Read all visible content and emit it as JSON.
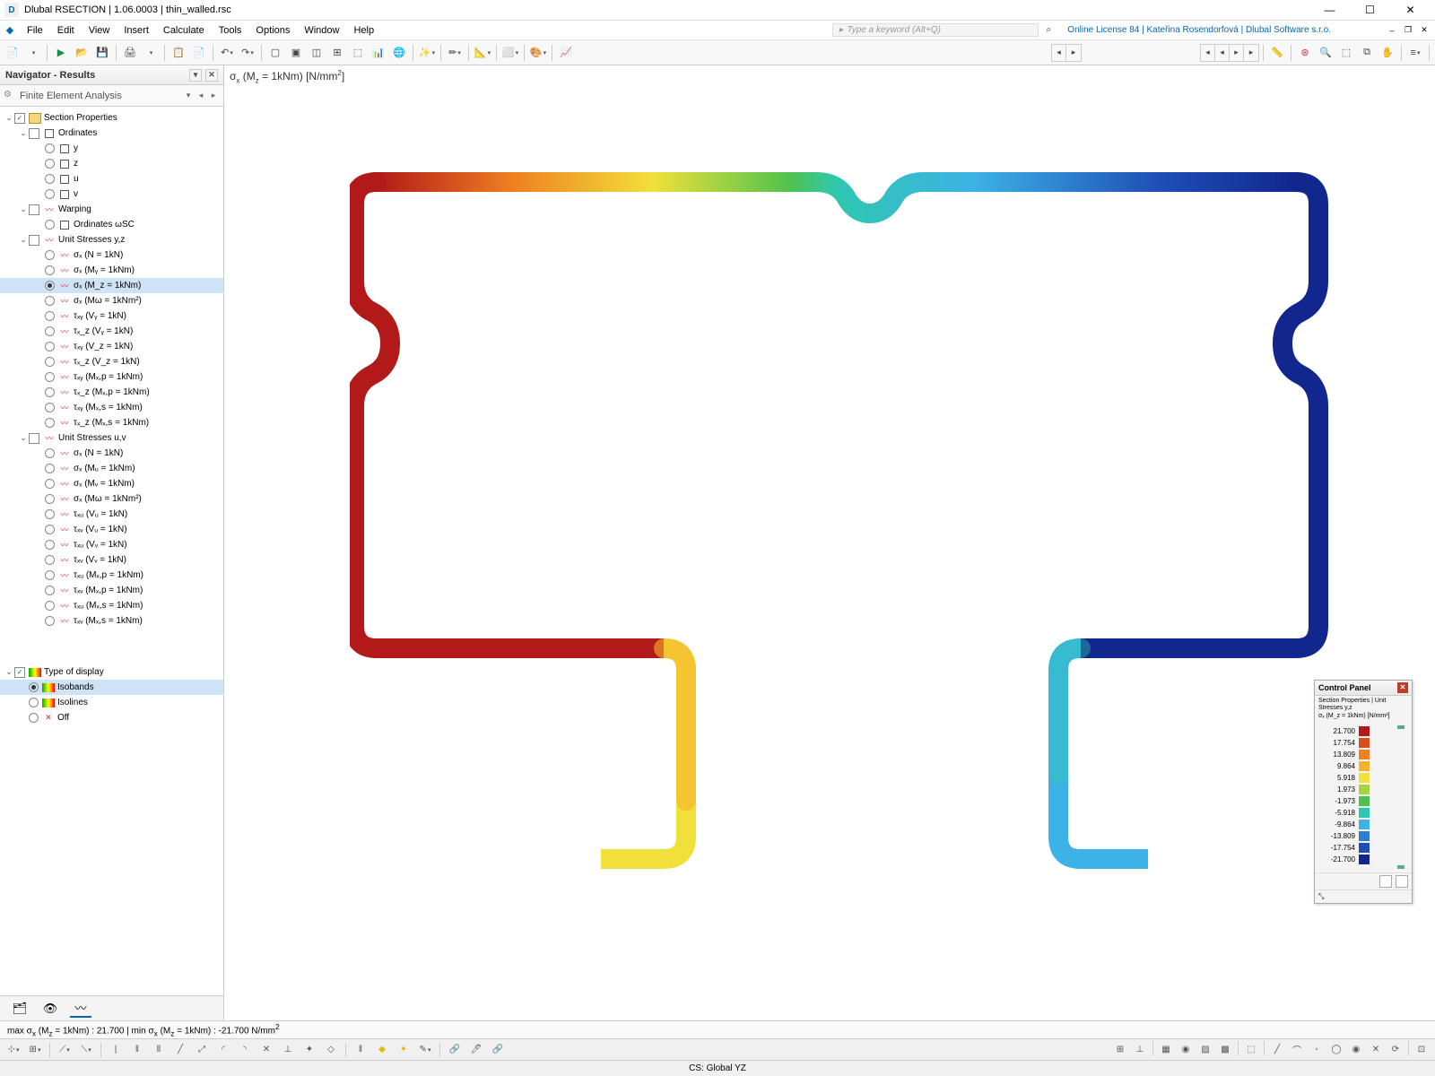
{
  "window": {
    "title": "Dlubal RSECTION | 1.06.0003 | thin_walled.rsc",
    "minimize": "—",
    "maximize": "☐",
    "close": "✕"
  },
  "menu": {
    "items": [
      "File",
      "Edit",
      "View",
      "Insert",
      "Calculate",
      "Tools",
      "Options",
      "Window",
      "Help"
    ],
    "search_placeholder": "Type a keyword (Alt+Q)",
    "license": "Online License 84 | Kateřina Rosendorfová | Dlubal Software s.r.o."
  },
  "navigator": {
    "title": "Navigator - Results",
    "dropdown": "Finite Element Analysis",
    "section_properties": {
      "label": "Section Properties",
      "ordinates": {
        "label": "Ordinates",
        "items": [
          "y",
          "z",
          "u",
          "v"
        ]
      },
      "warping": {
        "label": "Warping",
        "ord_wsc": "Ordinates ωSC"
      },
      "unit_yz": {
        "label": "Unit Stresses y,z",
        "items": [
          "σₓ (N = 1kN)",
          "σₓ (Mᵧ = 1kNm)",
          "σₓ (M_z = 1kNm)",
          "σₓ (Mω = 1kNm²)",
          "τₓᵧ (Vᵧ = 1kN)",
          "τₓ_z (Vᵧ = 1kN)",
          "τₓᵧ (V_z = 1kN)",
          "τₓ_z (V_z = 1kN)",
          "τₓᵧ (Mₓ,p = 1kNm)",
          "τₓ_z (Mₓ,p = 1kNm)",
          "τₓᵧ (Mₓ,s = 1kNm)",
          "τₓ_z (Mₓ,s = 1kNm)"
        ],
        "selected_index": 2
      },
      "unit_uv": {
        "label": "Unit Stresses u,v",
        "items": [
          "σₓ (N = 1kN)",
          "σₓ (Mᵤ = 1kNm)",
          "σₓ (Mᵥ = 1kNm)",
          "σₓ (Mω = 1kNm²)",
          "τₓᵤ (Vᵤ = 1kN)",
          "τₓᵥ (Vᵤ = 1kN)",
          "τₓᵤ (Vᵥ = 1kN)",
          "τₓᵥ (Vᵥ = 1kN)",
          "τₓᵤ (Mₓ,p = 1kNm)",
          "τₓᵥ (Mₓ,p = 1kNm)",
          "τₓᵤ (Mₓ,s = 1kNm)",
          "τₓᵥ (Mₓ,s = 1kNm)"
        ]
      }
    },
    "display_type": {
      "label": "Type of display",
      "options": [
        "Isobands",
        "Isolines",
        "Off"
      ],
      "selected_index": 0
    }
  },
  "viewport": {
    "title_html": "σ<sub>x</sub> (M<sub>z</sub> = 1kNm) [N/mm<sup>2</sup>]",
    "status_html": "max σ<sub>x</sub> (M<sub>z</sub> = 1kNm) : 21.700 | min σ<sub>x</sub> (M<sub>z</sub> = 1kNm) : -21.700 N/mm<sup>2</sup>"
  },
  "control_panel": {
    "title": "Control Panel",
    "subtitle": "Section Properties | Unit Stresses y,z\nσₓ (M_z = 1kNm) [N/mm²]",
    "scale": [
      {
        "v": "21.700",
        "c": "#b21919"
      },
      {
        "v": "17.754",
        "c": "#d84f1d"
      },
      {
        "v": "13.809",
        "c": "#ef8121"
      },
      {
        "v": "9.864",
        "c": "#f5b22c"
      },
      {
        "v": "5.918",
        "c": "#f2e03a"
      },
      {
        "v": "1.973",
        "c": "#a5d642"
      },
      {
        "v": "-1.973",
        "c": "#4fc24d"
      },
      {
        "v": "-5.918",
        "c": "#2fc7b0"
      },
      {
        "v": "-9.864",
        "c": "#3db2e6"
      },
      {
        "v": "-13.809",
        "c": "#2e7dd2"
      },
      {
        "v": "-17.754",
        "c": "#1f4fb5"
      },
      {
        "v": "-21.700",
        "c": "#11278e"
      }
    ]
  },
  "statusbar": {
    "cs": "CS: Global YZ"
  }
}
